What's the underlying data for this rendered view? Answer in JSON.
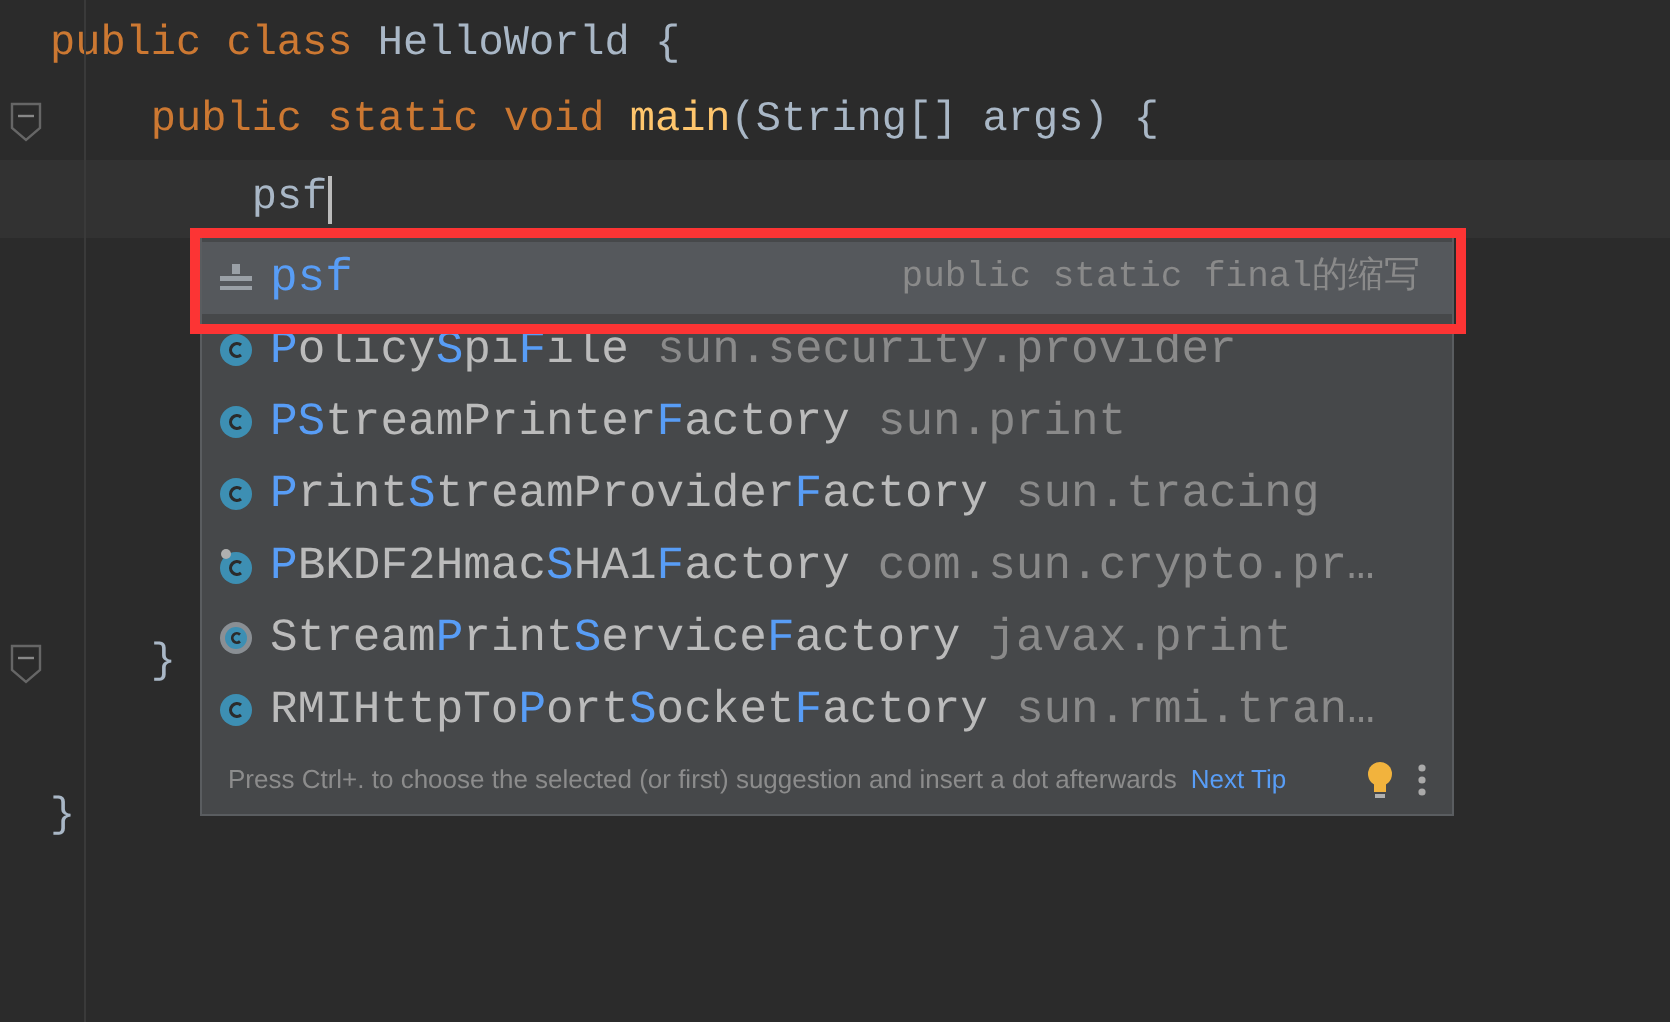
{
  "editor": {
    "lines": [
      {
        "kind": "code",
        "fold": false,
        "current": false,
        "tokens": [
          {
            "text": "public ",
            "kind": "keyword"
          },
          {
            "text": "class ",
            "kind": "keyword"
          },
          {
            "text": "HelloWorld {",
            "kind": "plain"
          }
        ]
      },
      {
        "kind": "code",
        "fold": true,
        "current": false,
        "tokens": [
          {
            "text": "    public ",
            "kind": "keyword"
          },
          {
            "text": "static ",
            "kind": "keyword"
          },
          {
            "text": "void ",
            "kind": "keyword"
          },
          {
            "text": "main",
            "kind": "method"
          },
          {
            "text": "(String[] args) {",
            "kind": "plain"
          }
        ]
      },
      {
        "kind": "code",
        "fold": false,
        "current": true,
        "tokens": [
          {
            "text": "        psf",
            "kind": "plain"
          }
        ]
      },
      {
        "kind": "blank"
      },
      {
        "kind": "blank"
      },
      {
        "kind": "blank"
      },
      {
        "kind": "blank"
      },
      {
        "kind": "blank"
      },
      {
        "kind": "code",
        "fold": true,
        "current": false,
        "tokens": [
          {
            "text": "    }",
            "kind": "plain"
          }
        ]
      },
      {
        "kind": "blank"
      },
      {
        "kind": "code",
        "fold": false,
        "current": false,
        "tokens": [
          {
            "text": "}",
            "kind": "plain"
          }
        ]
      }
    ]
  },
  "completion": {
    "items": [
      {
        "kind": "template",
        "selected": true,
        "parts": [
          {
            "text": "psf",
            "match": true
          }
        ],
        "detail": "public static final的缩写"
      },
      {
        "kind": "class",
        "selected": false,
        "parts": [
          {
            "text": "P",
            "match": true
          },
          {
            "text": "olicy",
            "match": false
          },
          {
            "text": "S",
            "match": true
          },
          {
            "text": "pi",
            "match": false
          },
          {
            "text": "F",
            "match": true
          },
          {
            "text": "ile",
            "match": false
          }
        ],
        "detail": "sun.security.provider"
      },
      {
        "kind": "class",
        "selected": false,
        "parts": [
          {
            "text": "PS",
            "match": true
          },
          {
            "text": "treamPrinter",
            "match": false
          },
          {
            "text": "F",
            "match": true
          },
          {
            "text": "actory",
            "match": false
          }
        ],
        "detail": "sun.print"
      },
      {
        "kind": "class",
        "selected": false,
        "parts": [
          {
            "text": "P",
            "match": true
          },
          {
            "text": "rint",
            "match": false
          },
          {
            "text": "S",
            "match": true
          },
          {
            "text": "treamProvider",
            "match": false
          },
          {
            "text": "F",
            "match": true
          },
          {
            "text": "actory",
            "match": false
          }
        ],
        "detail": "sun.tracing"
      },
      {
        "kind": "pinned-class",
        "selected": false,
        "parts": [
          {
            "text": "P",
            "match": true
          },
          {
            "text": "BKDF2Hmac",
            "match": false
          },
          {
            "text": "S",
            "match": true
          },
          {
            "text": "HA1",
            "match": false
          },
          {
            "text": "F",
            "match": true
          },
          {
            "text": "actory",
            "match": false
          }
        ],
        "detail": "com.sun.crypto.pr…"
      },
      {
        "kind": "abstract-class",
        "selected": false,
        "parts": [
          {
            "text": "Stream",
            "match": false
          },
          {
            "text": "P",
            "match": true
          },
          {
            "text": "rint",
            "match": false
          },
          {
            "text": "S",
            "match": true
          },
          {
            "text": "ervice",
            "match": false
          },
          {
            "text": "F",
            "match": true
          },
          {
            "text": "actory",
            "match": false
          }
        ],
        "detail": "javax.print"
      },
      {
        "kind": "class",
        "selected": false,
        "parts": [
          {
            "text": "RMIHttpTo",
            "match": false
          },
          {
            "text": "P",
            "match": true
          },
          {
            "text": "ort",
            "match": false
          },
          {
            "text": "S",
            "match": true
          },
          {
            "text": "ocket",
            "match": false
          },
          {
            "text": "F",
            "match": true
          },
          {
            "text": "actory",
            "match": false
          }
        ],
        "detail": "sun.rmi.tran…"
      }
    ],
    "tip": "Press Ctrl+. to choose the selected (or first) suggestion and insert a dot afterwards",
    "tip_link": "Next Tip"
  }
}
